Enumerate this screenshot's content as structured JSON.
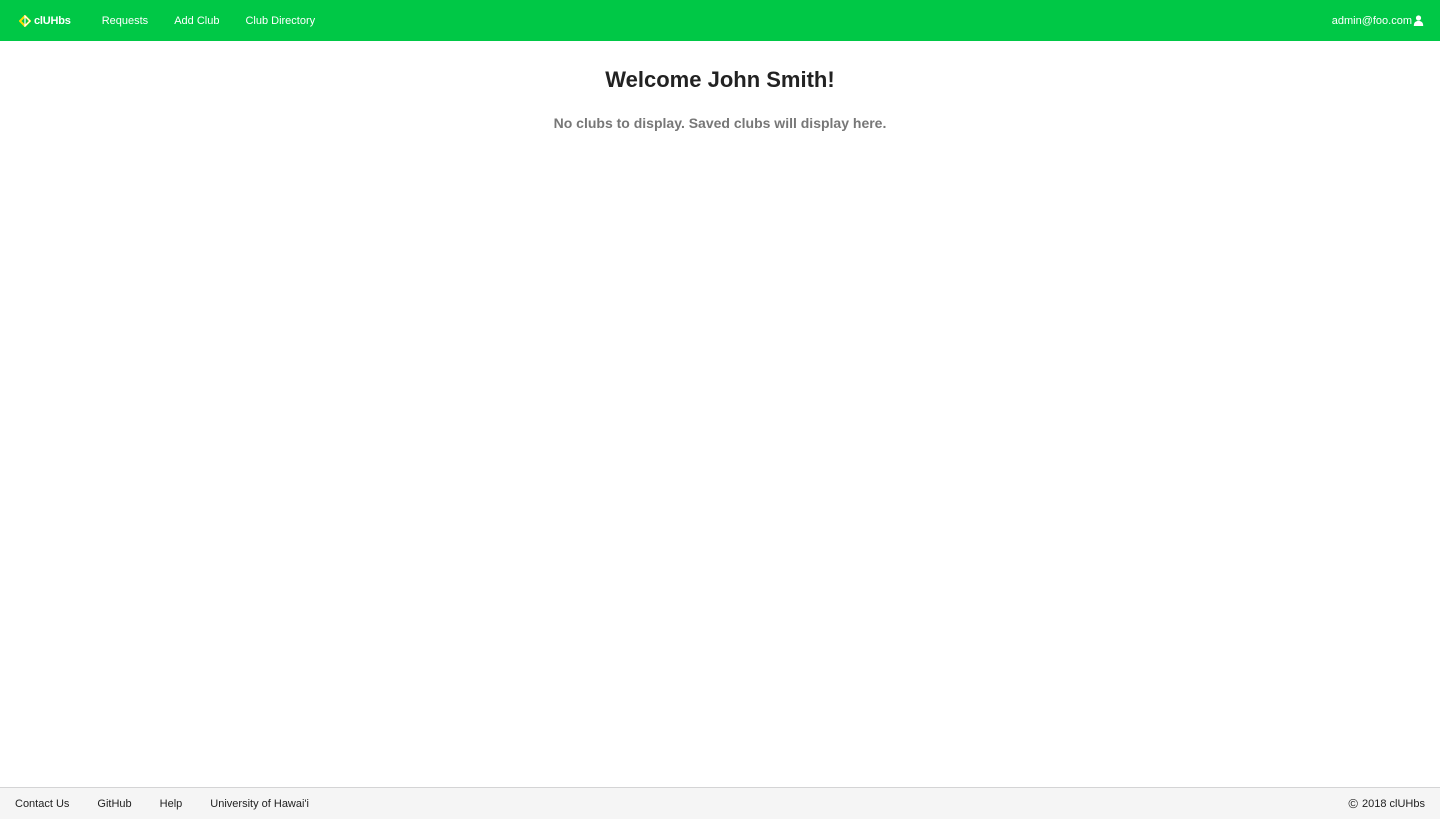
{
  "navbar": {
    "brand": {
      "label": "clUHbs",
      "icon": "diamond-outline-icon"
    },
    "items": [
      {
        "label": "Requests"
      },
      {
        "label": "Add Club"
      },
      {
        "label": "Club Directory"
      }
    ],
    "user": {
      "email": "admin@foo.com",
      "icon": "user-icon"
    }
  },
  "main": {
    "welcome": "Welcome John Smith!",
    "empty_message": "No clubs to display. Saved clubs will display here."
  },
  "footer": {
    "links": [
      {
        "label": "Contact Us"
      },
      {
        "label": "GitHub"
      },
      {
        "label": "Help"
      },
      {
        "label": "University of Hawai'i"
      }
    ],
    "copyright_symbol": "©",
    "copyright": "2018 clUHbs"
  },
  "colors": {
    "navbar_bg": "#00c846",
    "brand_icon_yellow": "#ffdd00",
    "footer_bg": "#f5f5f5"
  }
}
